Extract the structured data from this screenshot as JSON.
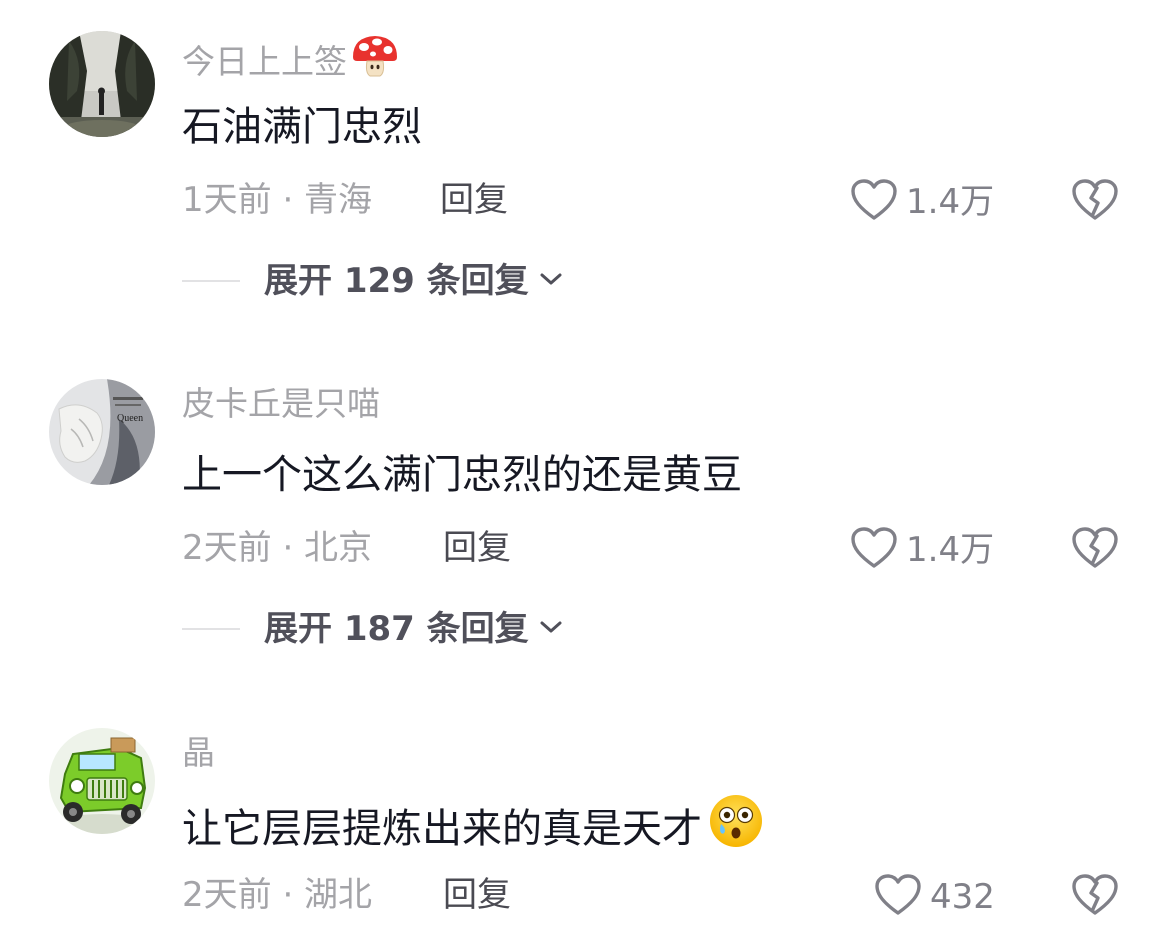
{
  "comments": [
    {
      "username": "今日上上签",
      "username_emoji": "mushroom-icon",
      "text": "石油满门忠烈",
      "time_location": "1天前 · 青海",
      "reply_label": "回复",
      "likes": "1.4万",
      "expand_label": "展开 129 条回复"
    },
    {
      "username": "皮卡丘是只喵",
      "text": "上一个这么满门忠烈的还是黄豆",
      "time_location": "2天前 · 北京",
      "reply_label": "回复",
      "likes": "1.4万",
      "expand_label": "展开 187 条回复"
    },
    {
      "username": "晶",
      "text": "让它层层提炼出来的真是天才",
      "text_emoji": "astonished-face-icon",
      "time_location": "2天前 · 湖北",
      "reply_label": "回复",
      "likes": "432"
    }
  ],
  "colors": {
    "username": "#a4a4a8",
    "text": "#161823",
    "meta": "#a4a4a8",
    "reply": "#4a4a52",
    "like_icon": "#808088",
    "expand": "#50505a"
  }
}
